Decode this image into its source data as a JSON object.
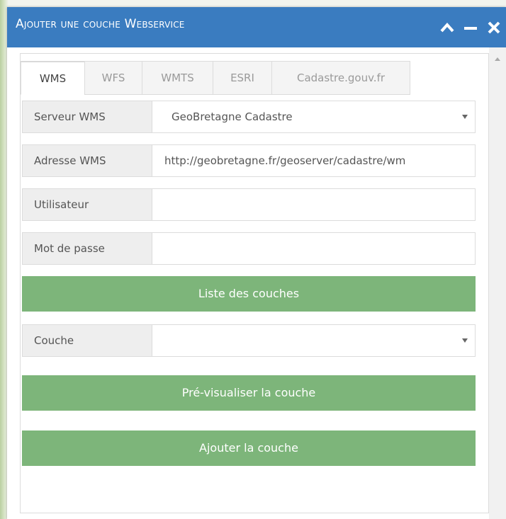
{
  "window": {
    "title": "Ajouter une couche Webservice"
  },
  "tabs": [
    {
      "label": "WMS",
      "active": true
    },
    {
      "label": "WFS",
      "active": false
    },
    {
      "label": "WMTS",
      "active": false
    },
    {
      "label": "ESRI",
      "active": false
    },
    {
      "label": "Cadastre.gouv.fr",
      "active": false
    }
  ],
  "form": {
    "server_label": "Serveur WMS",
    "server_value": "GeoBretagne Cadastre",
    "address_label": "Adresse WMS",
    "address_value": "http://geobretagne.fr/geoserver/cadastre/wm",
    "user_label": "Utilisateur",
    "user_value": "",
    "password_label": "Mot de passe",
    "password_value": "",
    "list_button": "Liste des couches",
    "layer_label": "Couche",
    "layer_value": "",
    "preview_button": "Pré-visualiser la couche",
    "add_button": "Ajouter la couche"
  },
  "colors": {
    "titlebar": "#3a7cc0",
    "button": "#7db57a"
  }
}
